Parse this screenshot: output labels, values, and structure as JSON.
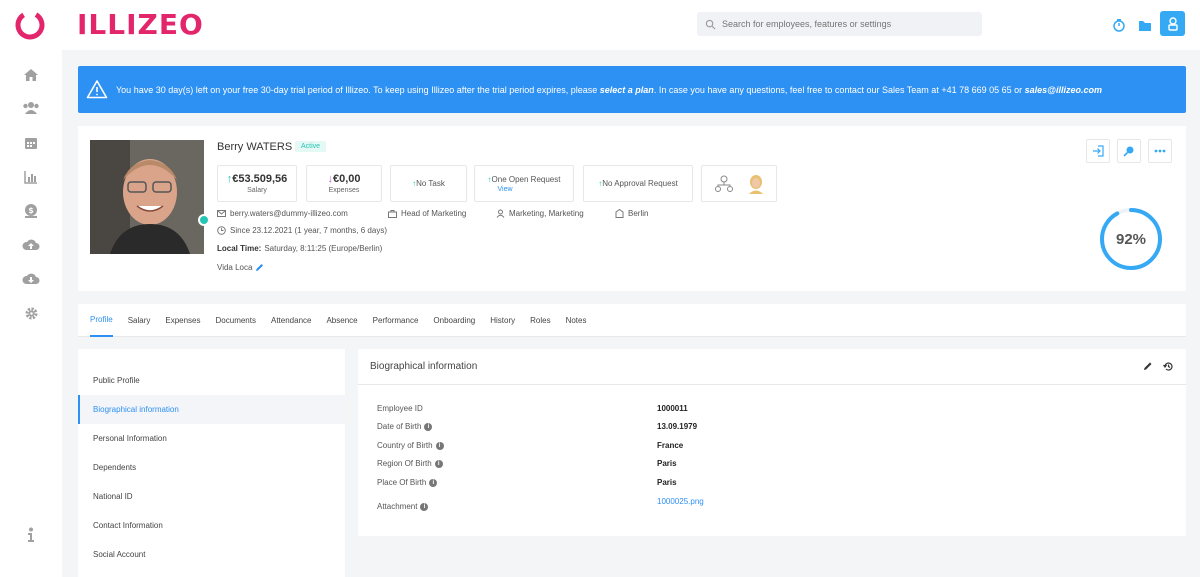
{
  "brand": {
    "name": "ILLIZEO",
    "color": "#e3256b",
    "accent": "#2d90f3"
  },
  "search": {
    "placeholder": "Search for employees, features or settings"
  },
  "sidebar": {
    "icons": [
      "home-icon",
      "users-icon",
      "calendar-icon",
      "chart-icon",
      "money-icon",
      "cloud-upload-icon",
      "cloud-download-icon",
      "gear-icon",
      "info-icon"
    ]
  },
  "banner": {
    "text_before": "You have 30 day(s) left on your free 30-day trial period of Illizeo. To keep using Illizeo after the trial period expires, please ",
    "link": "select a plan",
    "text_after": ". In case you have any questions, feel free to contact our Sales Team at +41 78 669 05 65 or ",
    "email": "sales@illizeo.com"
  },
  "profile": {
    "name": "Berry WATERS",
    "status": "Active",
    "salary_value": "€53.509,56",
    "salary_label": "Salary",
    "expenses_value": "€0,00",
    "expenses_label": "Expenses",
    "task": "No Task",
    "open_request": "One Open Request",
    "open_request_link": "View",
    "approval": "No Approval Request",
    "email": "berry.waters@dummy-illizeo.com",
    "role": "Head of Marketing",
    "department": "Marketing, Marketing",
    "location": "Berlin",
    "since": "Since 23.12.2021 (1 year, 7 months, 6 days)",
    "local_time_label": "Local Time:",
    "local_time": "Saturday, 8:11:25 (Europe/Berlin)",
    "motto": "Vida Loca",
    "completion": "92%",
    "completion_value": 0.92
  },
  "tabs": [
    "Profile",
    "Salary",
    "Expenses",
    "Documents",
    "Attendance",
    "Absence",
    "Performance",
    "Onboarding",
    "History",
    "Roles",
    "Notes"
  ],
  "left_menu": [
    "Public Profile",
    "Biographical information",
    "Personal Information",
    "Dependents",
    "National ID",
    "Contact Information",
    "Social Account"
  ],
  "bio": {
    "title": "Biographical information",
    "fields": [
      {
        "label": "Employee ID",
        "value": "1000011"
      },
      {
        "label": "Date of Birth",
        "value": "13.09.1979"
      },
      {
        "label": "Country of Birth",
        "value": "France"
      },
      {
        "label": "Region Of Birth",
        "value": "Paris"
      },
      {
        "label": "Place Of Birth",
        "value": "Paris"
      },
      {
        "label": "Attachment",
        "value": "1000025.png"
      }
    ]
  }
}
